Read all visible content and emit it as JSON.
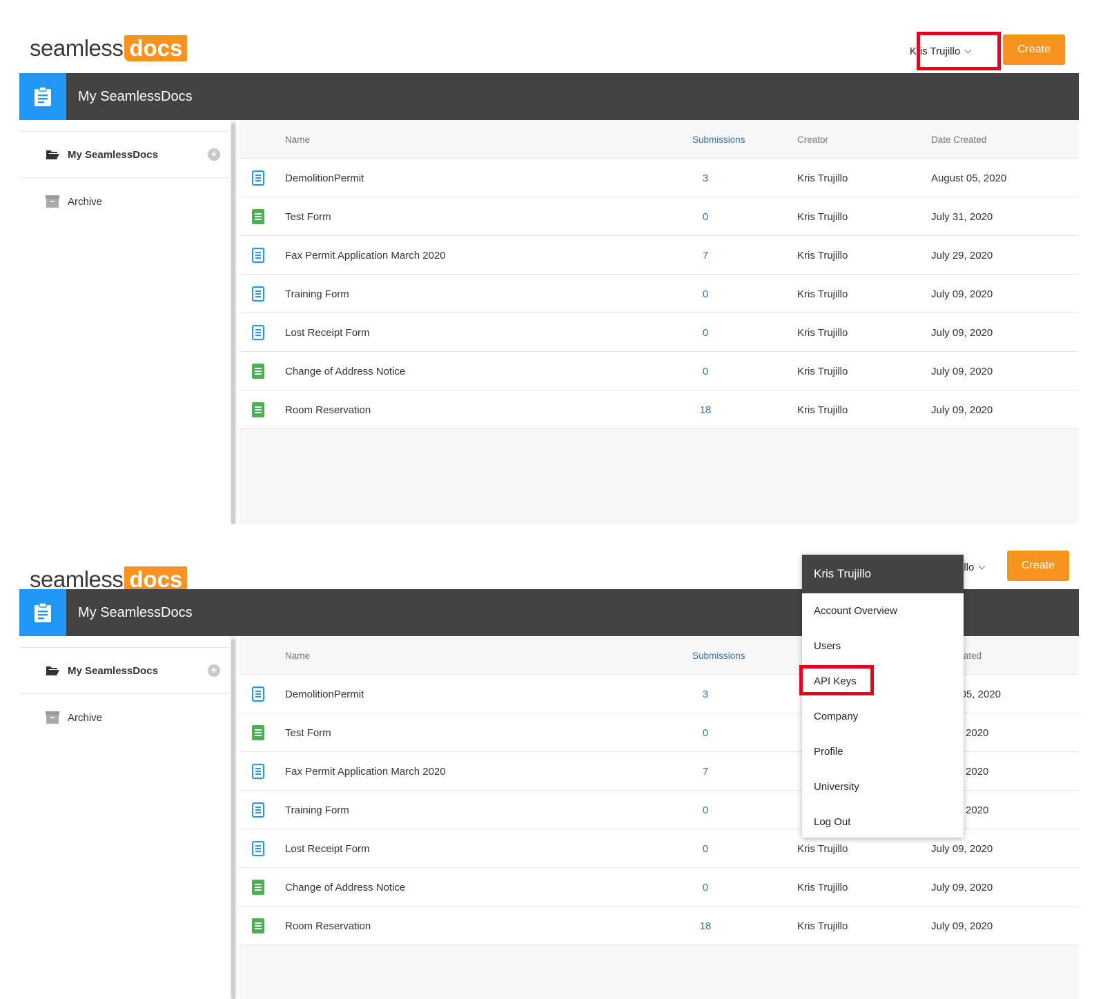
{
  "logo": {
    "text_plain": "seamless",
    "text_badge": "docs"
  },
  "header": {
    "user_label": "Kris Trujillo",
    "user_label_partial": "jillo",
    "create_label": "Create"
  },
  "topbar": {
    "title": "My SeamlessDocs"
  },
  "sidebar": {
    "items": [
      {
        "label": "My SeamlessDocs",
        "icon": "folder-open-icon"
      },
      {
        "label": "Archive",
        "icon": "archive-box-icon"
      }
    ]
  },
  "table": {
    "headers": {
      "name": "Name",
      "submissions": "Submissions",
      "creator": "Creator",
      "date": "Date Created",
      "date_partial": "te Created"
    },
    "rows": [
      {
        "name": "DemolitionPermit",
        "submissions": "3",
        "creator": "Kris Trujillo",
        "date": "August 05, 2020",
        "date_partial": "gust 05, 2020",
        "icon_color": "#2196f3"
      },
      {
        "name": "Test Form",
        "submissions": "0",
        "creator": "Kris Trujillo",
        "date": "July 31, 2020",
        "date_partial": "ly 31, 2020",
        "icon_color": "#4caf50"
      },
      {
        "name": "Fax Permit Application March 2020",
        "submissions": "7",
        "creator": "Kris Trujillo",
        "date": "July 29, 2020",
        "date_partial": "ly 29, 2020",
        "icon_color": "#2196f3"
      },
      {
        "name": "Training Form",
        "submissions": "0",
        "creator": "Kris Trujillo",
        "date": "July 09, 2020",
        "date_partial": "ly 09, 2020",
        "icon_color": "#2196f3"
      },
      {
        "name": "Lost Receipt Form",
        "submissions": "0",
        "creator": "Kris Trujillo",
        "date": "July 09, 2020",
        "date_partial": "July 09, 2020",
        "icon_color": "#2196f3"
      },
      {
        "name": "Change of Address Notice",
        "submissions": "0",
        "creator": "Kris Trujillo",
        "date": "July 09, 2020",
        "date_partial": "July 09, 2020",
        "icon_color": "#4caf50"
      },
      {
        "name": "Room Reservation",
        "submissions": "18",
        "creator": "Kris Trujillo",
        "date": "July 09, 2020",
        "date_partial": "July 09, 2020",
        "icon_color": "#4caf50"
      }
    ]
  },
  "menu": {
    "title": "Kris Trujillo",
    "items": [
      "Account Overview",
      "Users",
      "API Keys",
      "Company",
      "Profile",
      "University",
      "Log Out"
    ]
  },
  "colors": {
    "accent": "#f7931e",
    "topbar": "#434343",
    "highlight": "#e8001c",
    "blue": "#2196f3",
    "green": "#4caf50"
  }
}
